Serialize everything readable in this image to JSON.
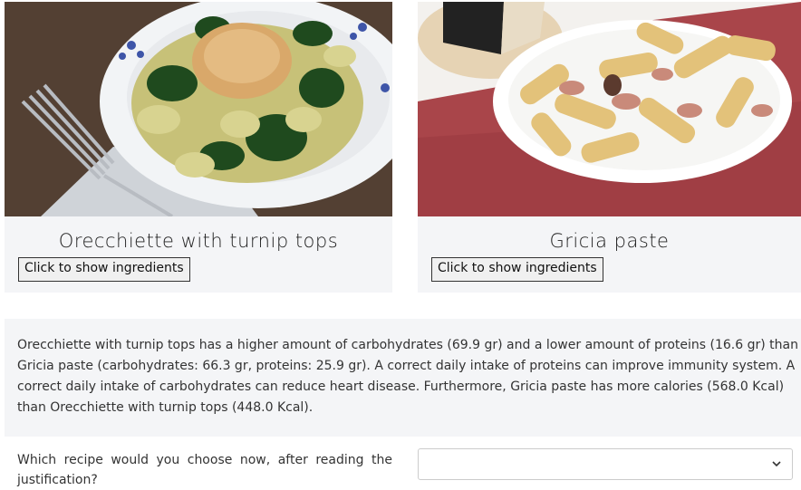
{
  "recipes": [
    {
      "title": "Orecchiette with turnip tops",
      "button_label": "Click to show ingredients"
    },
    {
      "title": "Gricia paste",
      "button_label": "Click to show ingredients"
    }
  ],
  "justification": {
    "text": "Orecchiette with turnip tops has a higher amount of carbohydrates (69.9 gr) and a lower amount of proteins (16.6 gr) than Gricia paste (carbohydrates: 66.3 gr, proteins: 25.9 gr). A correct daily intake of proteins can improve immunity system. A correct daily intake of carbohydrates can reduce heart disease. Furthermore, Gricia paste has more calories (568.0 Kcal) than Orecchiette with turnip tops (448.0 Kcal)."
  },
  "question": {
    "text": "Which recipe would you choose now, after reading the justification?",
    "selected_value": ""
  },
  "icons": {
    "select_arrow": "chevron-down-icon"
  }
}
